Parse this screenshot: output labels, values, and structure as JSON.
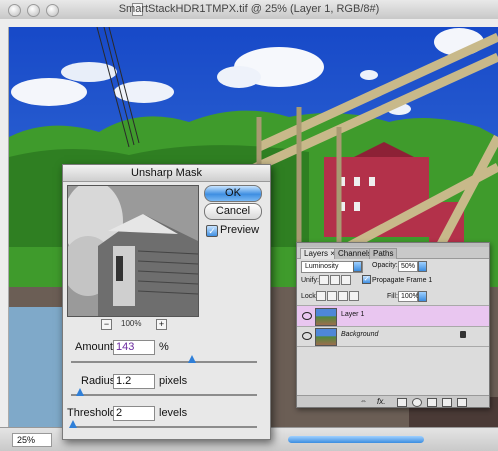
{
  "document": {
    "title": "SmartStackHDR1TMPX.tif @ 25% (Layer 1, RGB/8#)",
    "zoom": "25%"
  },
  "dialog": {
    "title": "Unsharp Mask",
    "ok_label": "OK",
    "cancel_label": "Cancel",
    "preview_label": "Preview",
    "preview_checked": true,
    "preview_zoom": "100%",
    "zoom_out_label": "−",
    "zoom_in_label": "+",
    "amount": {
      "label": "Amount:",
      "value": "143",
      "unit": "%",
      "slider_fraction": 0.65
    },
    "radius": {
      "label": "Radius:",
      "value": "1.2",
      "unit": "pixels",
      "slider_fraction": 0.05
    },
    "threshold": {
      "label": "Threshold:",
      "value": "2",
      "unit": "levels",
      "slider_fraction": 0.01
    }
  },
  "layers_panel": {
    "tabs": [
      "Layers",
      "Channels",
      "Paths"
    ],
    "tab_close": "×",
    "blend_mode": "Luminosity",
    "opacity_label": "Opacity:",
    "opacity_value": "50%",
    "unify_label": "Unify:",
    "propagate_label": "Propagate Frame 1",
    "lock_label": "Lock:",
    "fill_label": "Fill:",
    "fill_value": "100%",
    "layers": [
      {
        "name": "Layer 1",
        "selected": true,
        "locked": false
      },
      {
        "name": "Background",
        "selected": false,
        "locked": true
      }
    ],
    "fx_label": "fx."
  },
  "colors": {
    "accent": "#3f8fe2",
    "selected_layer": "#e9c6f0"
  }
}
